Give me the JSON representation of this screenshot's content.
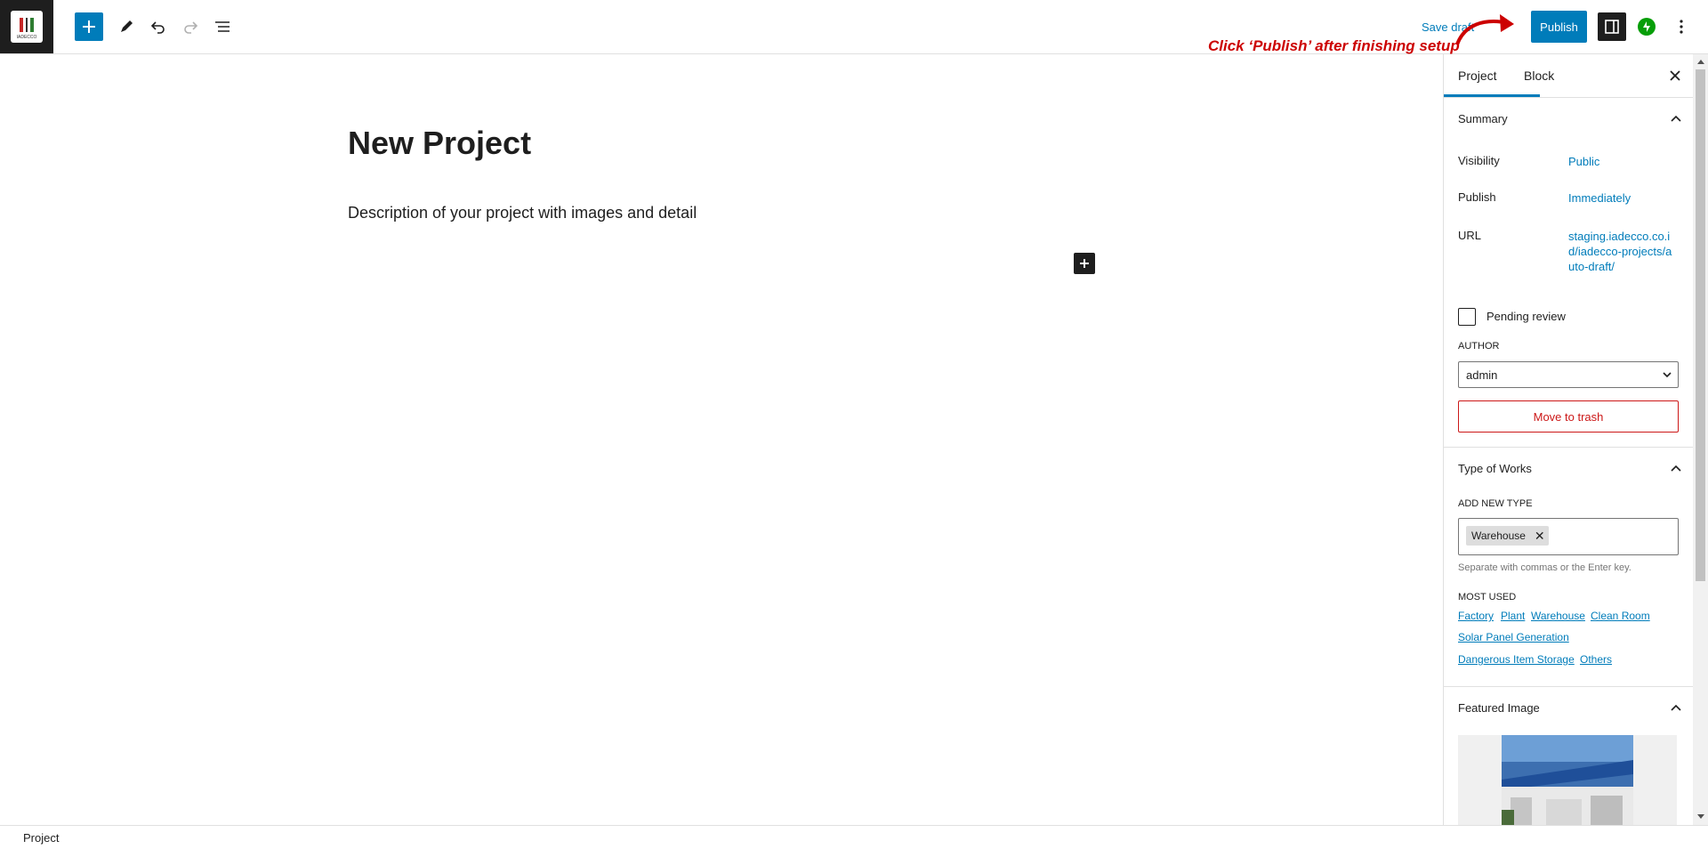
{
  "header": {
    "logo_text": "IADECCO",
    "save_draft_label": "Save draft",
    "publish_label": "Publish",
    "annotation_text": "Click ‘Publish’ after finishing setup",
    "icons": [
      "plus-icon",
      "pencil-icon",
      "undo-icon",
      "redo-icon",
      "list-view-icon",
      "sidebar-toggle-icon",
      "jetpack-icon",
      "more-vertical-icon"
    ]
  },
  "editor": {
    "title": "New Project",
    "description": "Description of your project with images and detail"
  },
  "sidebar": {
    "tabs": [
      "Project",
      "Block"
    ],
    "summary": {
      "title": "Summary",
      "visibility_label": "Visibility",
      "visibility_value": "Public",
      "publish_label": "Publish",
      "publish_value": "Immediately",
      "url_label": "URL",
      "url_value": "staging.iadecco.co.id/iadecco-projects/auto-draft/",
      "pending_review_label": "Pending review",
      "author_label": "AUTHOR",
      "author_value": "admin",
      "trash_label": "Move to trash"
    },
    "type_of_works": {
      "title": "Type of Works",
      "add_new_label": "ADD NEW TYPE",
      "tag": "Warehouse",
      "help_text": "Separate with commas or the Enter key.",
      "most_used_label": "MOST USED",
      "most_used": [
        "Factory",
        "Plant",
        "Warehouse",
        "Clean Room",
        "Solar Panel Generation",
        "Dangerous Item Storage",
        "Others"
      ]
    },
    "featured_image": {
      "title": "Featured Image"
    }
  },
  "footer": {
    "breadcrumb": "Project"
  },
  "colors": {
    "accent": "#007cba",
    "danger": "#cc1818",
    "annotation": "#cc0000",
    "dark": "#1e1e1e"
  }
}
